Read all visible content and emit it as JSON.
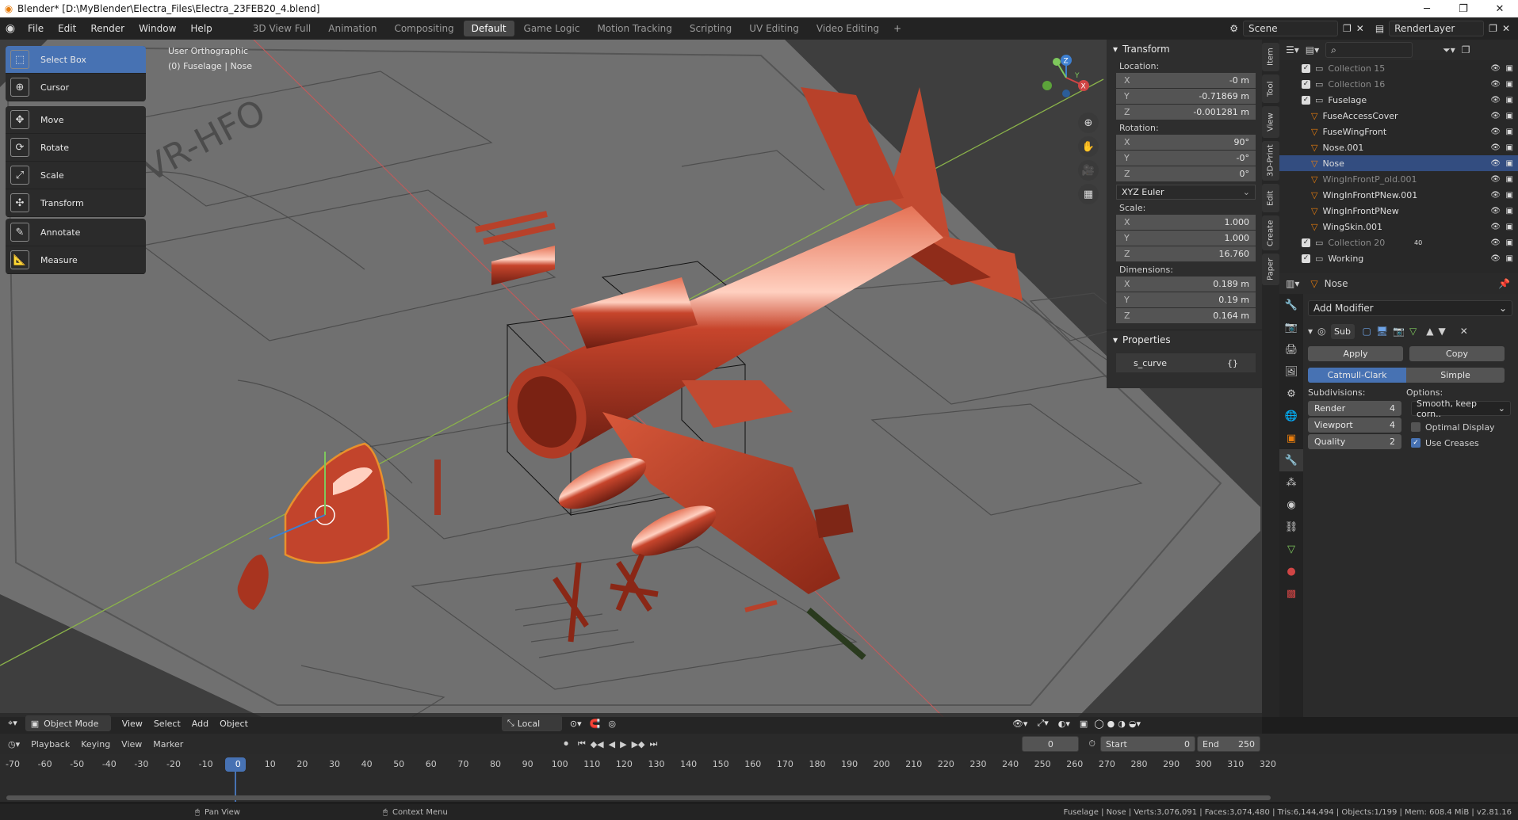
{
  "window": {
    "title": "Blender* [D:\\MyBlender\\Electra_Files\\Electra_23FEB20_4.blend]",
    "controls": [
      "─",
      "❐",
      "✕"
    ]
  },
  "menubar": {
    "menus": [
      "File",
      "Edit",
      "Render",
      "Window",
      "Help"
    ],
    "workspaces": [
      "3D View Full",
      "Animation",
      "Compositing",
      "Default",
      "Game Logic",
      "Motion Tracking",
      "Scripting",
      "UV Editing",
      "Video Editing"
    ],
    "active_workspace": "Default",
    "scene": "Scene",
    "view_layer": "RenderLayer"
  },
  "toolbar": {
    "select_box": "Select Box",
    "cursor": "Cursor",
    "move": "Move",
    "rotate": "Rotate",
    "scale": "Scale",
    "transform": "Transform",
    "annotate": "Annotate",
    "measure": "Measure"
  },
  "viewport": {
    "view_name": "User Orthographic",
    "object_info": "(0) Fuselage | Nose",
    "axes": {
      "x": "X",
      "y": "Y",
      "z": "Z"
    }
  },
  "npanel": {
    "title": "Transform",
    "location_label": "Location:",
    "location": {
      "x": "-0 m",
      "y": "-0.71869 m",
      "z": "-0.001281 m"
    },
    "rotation_label": "Rotation:",
    "rotation": {
      "x": "90°",
      "y": "-0°",
      "z": "0°"
    },
    "rotation_mode": "XYZ Euler",
    "scale_label": "Scale:",
    "scale": {
      "x": "1.000",
      "y": "1.000",
      "z": "16.760"
    },
    "dimensions_label": "Dimensions:",
    "dimensions": {
      "x": "0.189 m",
      "y": "0.19 m",
      "z": "0.164 m"
    },
    "properties_title": "Properties",
    "custom_prop_name": "s_curve",
    "custom_prop_value": "{}",
    "axis_labels": {
      "x": "X",
      "y": "Y",
      "z": "Z"
    }
  },
  "sidetabs": [
    "Item",
    "Tool",
    "View",
    "3D-Print",
    "Edit",
    "Create",
    "Paper"
  ],
  "outliner": {
    "rows": [
      {
        "label": "Collection 15",
        "dim": true,
        "indent": 0
      },
      {
        "label": "Collection 16",
        "dim": true,
        "indent": 0
      },
      {
        "label": "Fuselage",
        "dim": false,
        "indent": 0
      },
      {
        "label": "FuseAccessCover",
        "dim": false,
        "indent": 1
      },
      {
        "label": "FuseWingFront",
        "dim": false,
        "indent": 1
      },
      {
        "label": "Nose.001",
        "dim": false,
        "indent": 1
      },
      {
        "label": "Nose",
        "dim": false,
        "indent": 1,
        "selected": true
      },
      {
        "label": "WingInFrontP_old.001",
        "dim": true,
        "indent": 1
      },
      {
        "label": "WingInFrontPNew.001",
        "dim": false,
        "indent": 1
      },
      {
        "label": "WingInFrontPNew",
        "dim": false,
        "indent": 1
      },
      {
        "label": "WingSkin.001",
        "dim": false,
        "indent": 1
      },
      {
        "label": "Collection 20",
        "dim": true,
        "indent": 0
      },
      {
        "label": "Working",
        "dim": false,
        "indent": 0
      }
    ],
    "collection20_badge": "40"
  },
  "properties": {
    "object_name": "Nose",
    "add_modifier": "Add Modifier",
    "modifier_name": "Sub",
    "apply": "Apply",
    "copy": "Copy",
    "catmull_clark": "Catmull-Clark",
    "simple": "Simple",
    "subdivisions_label": "Subdivisions:",
    "options_label": "Options:",
    "render_label": "Render",
    "render_value": "4",
    "viewport_label": "Viewport",
    "viewport_value": "4",
    "quality_label": "Quality",
    "quality_value": "2",
    "uv_smooth": "Smooth, keep corn..",
    "optimal_display": "Optimal Display",
    "use_creases": "Use Creases"
  },
  "viewport_header": {
    "mode": "Object Mode",
    "menus": [
      "View",
      "Select",
      "Add",
      "Object"
    ],
    "orientation": "Local"
  },
  "timeline": {
    "menus": [
      "Playback",
      "Keying",
      "View",
      "Marker"
    ],
    "current_frame": "0",
    "start_label": "Start",
    "start": "0",
    "end_label": "End",
    "end": "250",
    "ruler": [
      "-70",
      "-60",
      "-50",
      "-40",
      "-30",
      "-20",
      "-10",
      "0",
      "10",
      "20",
      "30",
      "40",
      "50",
      "60",
      "70",
      "80",
      "90",
      "100",
      "110",
      "120",
      "130",
      "140",
      "150",
      "160",
      "170",
      "180",
      "190",
      "200",
      "210",
      "220",
      "230",
      "240",
      "250",
      "260",
      "270",
      "280",
      "290",
      "300",
      "310",
      "320"
    ]
  },
  "statusbar": {
    "left": "Pan View",
    "mid": "Context Menu",
    "stats": "Fuselage | Nose | Verts:3,076,091 | Faces:3,074,480 | Tris:6,144,494 | Objects:1/199 | Mem: 608.4 MiB | v2.81.16"
  },
  "colors": {
    "accent": "#4772b3",
    "model": "#c2442c",
    "selection": "#e8912c"
  }
}
